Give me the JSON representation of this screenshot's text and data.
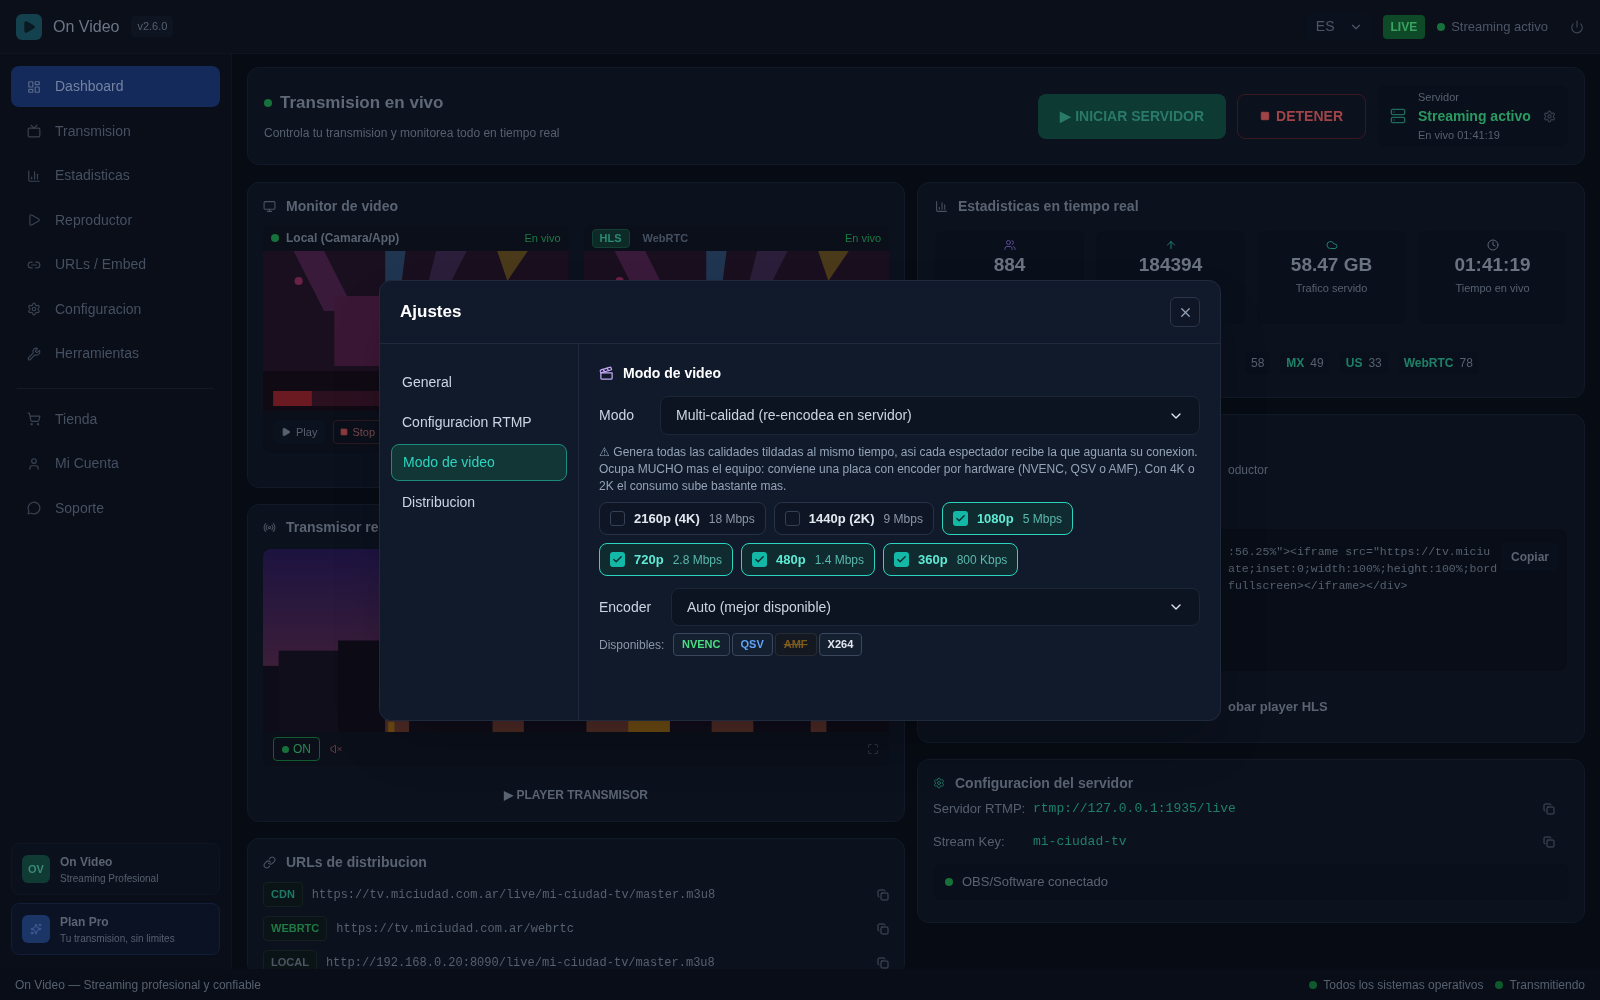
{
  "header": {
    "app_name": "On Video",
    "version": "v2.6.0",
    "language": "ES",
    "live_badge": "LIVE",
    "status": "Streaming activo"
  },
  "sidebar": {
    "items": [
      {
        "label": "Dashboard",
        "selected": true
      },
      {
        "label": "Transmision",
        "selected": false
      },
      {
        "label": "Estadisticas",
        "selected": false
      },
      {
        "label": "Reproductor",
        "selected": false
      },
      {
        "label": "URLs / Embed",
        "selected": false
      },
      {
        "label": "Configuracion",
        "selected": false
      },
      {
        "label": "Herramientas",
        "selected": false
      }
    ],
    "secondary_items": [
      {
        "label": "Tienda",
        "selected": false
      },
      {
        "label": "Mi Cuenta",
        "selected": false
      },
      {
        "label": "Soporte",
        "selected": false
      }
    ],
    "brand_card": {
      "initials": "OV",
      "title": "On Video",
      "subtitle": "Streaming Profesional"
    },
    "plan_card": {
      "title": "Plan Pro",
      "subtitle": "Tu transmision, sin limites"
    }
  },
  "hero": {
    "title": "Transmision en vivo",
    "subtitle": "Controla tu transmision y monitorea todo en tiempo real",
    "start_button": "▶ INICIAR SERVIDOR",
    "stop_button": "DETENER",
    "server": {
      "label": "Servidor",
      "status": "Streaming activo",
      "uptime": "En vivo 01:41:19"
    }
  },
  "monitor": {
    "title": "Monitor de video",
    "local": {
      "title": "Local (Camara/App)",
      "status": "En vivo",
      "controls": [
        "Play",
        "Stop"
      ]
    },
    "remote": {
      "tabs": [
        {
          "label": "HLS",
          "selected": true
        },
        {
          "label": "WebRTC",
          "selected": false
        }
      ],
      "status": "En vivo"
    }
  },
  "transmitter": {
    "title": "Transmisor re",
    "on_button": "ON",
    "footer_button": "▶ PLAYER TRANSMISOR"
  },
  "urls": {
    "title": "URLs de distribucion",
    "rows": [
      {
        "tag": "CDN",
        "url": "https://tv.miciudad.com.ar/live/mi-ciudad-tv/master.m3u8",
        "color": "#1d7a68"
      },
      {
        "tag": "WEBRTC",
        "url": "https://tv.miciudad.com.ar/webrtc",
        "color": "#1f7a45"
      },
      {
        "tag": "LOCAL",
        "url": "http://192.168.0.20:8090/live/mi-ciudad-tv/master.m3u8",
        "color": "#4b5563"
      }
    ]
  },
  "stats": {
    "title": "Estadisticas en tiempo real",
    "cards": [
      {
        "value": "884"
      },
      {
        "value": "184394"
      },
      {
        "value": "58.47 GB",
        "label": "Trafico servido"
      },
      {
        "value": "01:41:19",
        "label": "Tiempo en vivo"
      }
    ],
    "chips": [
      {
        "count": "58"
      },
      {
        "code": "MX",
        "count": "49"
      },
      {
        "code": "US",
        "count": "33"
      },
      {
        "code": "WebRTC",
        "count": "78"
      }
    ]
  },
  "embed": {
    "hint": "oductor",
    "code_lines": [
      ":56.25%\"><iframe src=\"https://tv.miciu",
      "ate;inset:0;width:100%;height:100%;bord",
      "fullscreen></iframe></div>"
    ],
    "copy_button": "Copiar",
    "test_button": "obar player HLS"
  },
  "server_config": {
    "title": "Configuracion del servidor",
    "rows": [
      {
        "label": "Servidor RTMP:",
        "value": "rtmp://127.0.0.1:1935/live"
      },
      {
        "label": "Stream Key:",
        "value": "mi-ciudad-tv"
      }
    ],
    "connection": "OBS/Software conectado"
  },
  "footer": {
    "text": "On Video — Streaming profesional y confiable",
    "statuses": [
      "Todos los sistemas operativos",
      "Transmitiendo"
    ]
  },
  "modal": {
    "title": "Ajustes",
    "nav": [
      {
        "label": "General",
        "selected": false
      },
      {
        "label": "Configuracion RTMP",
        "selected": false
      },
      {
        "label": "Modo de video",
        "selected": true
      },
      {
        "label": "Distribucion",
        "selected": false
      }
    ],
    "section_title": "Modo de video",
    "mode": {
      "label": "Modo",
      "value": "Multi-calidad (re-encodea en servidor)"
    },
    "warning": "⚠ Genera todas las calidades tildadas al mismo tiempo, asi cada espectador recibe la que aguanta su conexion. Ocupa MUCHO mas el equipo: conviene una placa con encoder por hardware (NVENC, QSV o AMF). Con 4K o 2K el consumo sube bastante mas.",
    "qualities": [
      {
        "label": "2160p (4K)",
        "bitrate": "18 Mbps",
        "checked": false
      },
      {
        "label": "1440p (2K)",
        "bitrate": "9 Mbps",
        "checked": false
      },
      {
        "label": "1080p",
        "bitrate": "5 Mbps",
        "checked": true
      },
      {
        "label": "720p",
        "bitrate": "2.8 Mbps",
        "checked": true
      },
      {
        "label": "480p",
        "bitrate": "1.4 Mbps",
        "checked": true
      },
      {
        "label": "360p",
        "bitrate": "800 Kbps",
        "checked": true
      }
    ],
    "encoder": {
      "label": "Encoder",
      "value": "Auto (mejor disponible)"
    },
    "available": {
      "label": "Disponibles:",
      "encoders": [
        {
          "name": "NVENC",
          "color": "#4ade80",
          "available": true
        },
        {
          "name": "QSV",
          "color": "#60a5fa",
          "available": true
        },
        {
          "name": "AMF",
          "color": "#7c5a1e",
          "available": false
        },
        {
          "name": "X264",
          "color": "#e2e8f0",
          "available": true
        }
      ]
    }
  }
}
